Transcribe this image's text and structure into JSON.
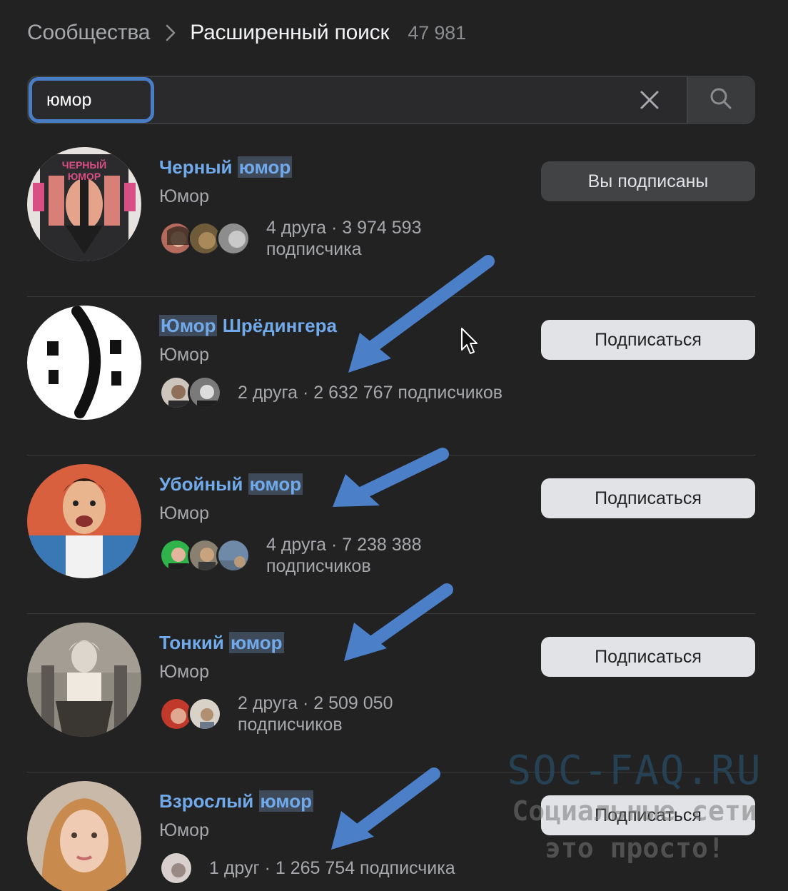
{
  "breadcrumb": {
    "root": "Сообщества",
    "current": "Расширенный поиск",
    "count": "47 981"
  },
  "search": {
    "value": "юмор",
    "icons": {
      "clear": "close-icon",
      "submit": "search-icon"
    }
  },
  "results": [
    {
      "name_plain": "Черный ",
      "name_highlight": "юмор",
      "category": "Юмор",
      "stats": "4 друга · 3 974 593 подписчика",
      "button": "Вы подписаны",
      "friends": 3,
      "colors": [
        "#b46a5c",
        "#6f5a3a",
        "#8d8d8d"
      ]
    },
    {
      "name_highlight": "Юмор",
      "name_plain": " Шрёдингера",
      "category": "Юмор",
      "stats": "2 друга · 2 632 767 подписчиков",
      "button": "Подписаться",
      "friends": 2,
      "colors": [
        "#ccc6bd",
        "#7a7a7a"
      ]
    },
    {
      "name_plain": "Убойный ",
      "name_highlight": "юмор",
      "category": "Юмор",
      "stats": "4 друга · 7 238 388 подписчиков",
      "button": "Подписаться",
      "friends": 3,
      "colors": [
        "#2fb34a",
        "#8a8070",
        "#6f89a8"
      ]
    },
    {
      "name_plain": "Тонкий ",
      "name_highlight": "юмор",
      "category": "Юмор",
      "stats": "2 друга · 2 509 050 подписчиков",
      "button": "Подписаться",
      "friends": 2,
      "colors": [
        "#c0392b",
        "#d8d2c8"
      ]
    },
    {
      "name_plain": "Взрослый ",
      "name_highlight": "юмор",
      "category": "Юмор",
      "stats": "1 друг · 1 265 754 подписчика",
      "button": "Подписаться",
      "friends": 1,
      "colors": [
        "#d7d0cc"
      ]
    }
  ],
  "watermark": {
    "title": "SOC-FAQ.RU",
    "line1": "Социальные сети",
    "line2": "это просто!"
  },
  "accent": "#71aaeb"
}
